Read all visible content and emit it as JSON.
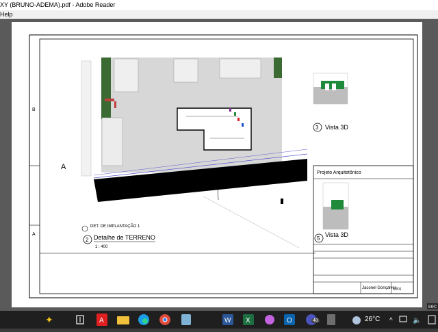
{
  "window": {
    "title": "XY (BRUNO-ADEMA).pdf - Adobe Reader",
    "menu_help": "Help"
  },
  "drawing": {
    "zone_b": "B",
    "zone_a_big": "A",
    "zone_a": "A",
    "detail_number": "2",
    "detail_small_label": "DET. DE IMPLANTAÇÃO 1",
    "detail_title": "Detalhe de TERRENO",
    "detail_scale": "1 : 400",
    "view3d_number": "3",
    "view3d_title": "Vista 3D",
    "view5_number": "5",
    "view5_title": "Vista 3D",
    "project_heading": "Projeto Arquitetônico",
    "author_name": "Jaconel Gonçalves",
    "sheet_code": "01/01"
  },
  "taskbar": {
    "temperature": "26°C",
    "notification_count": "48",
    "corner_label": "sec"
  },
  "colors": {
    "accent_green": "#1f8a3a",
    "edge_red": "#e02020",
    "excel_green": "#1d6f42",
    "word_blue": "#2b579a",
    "outlook_blue": "#0a64ad"
  }
}
